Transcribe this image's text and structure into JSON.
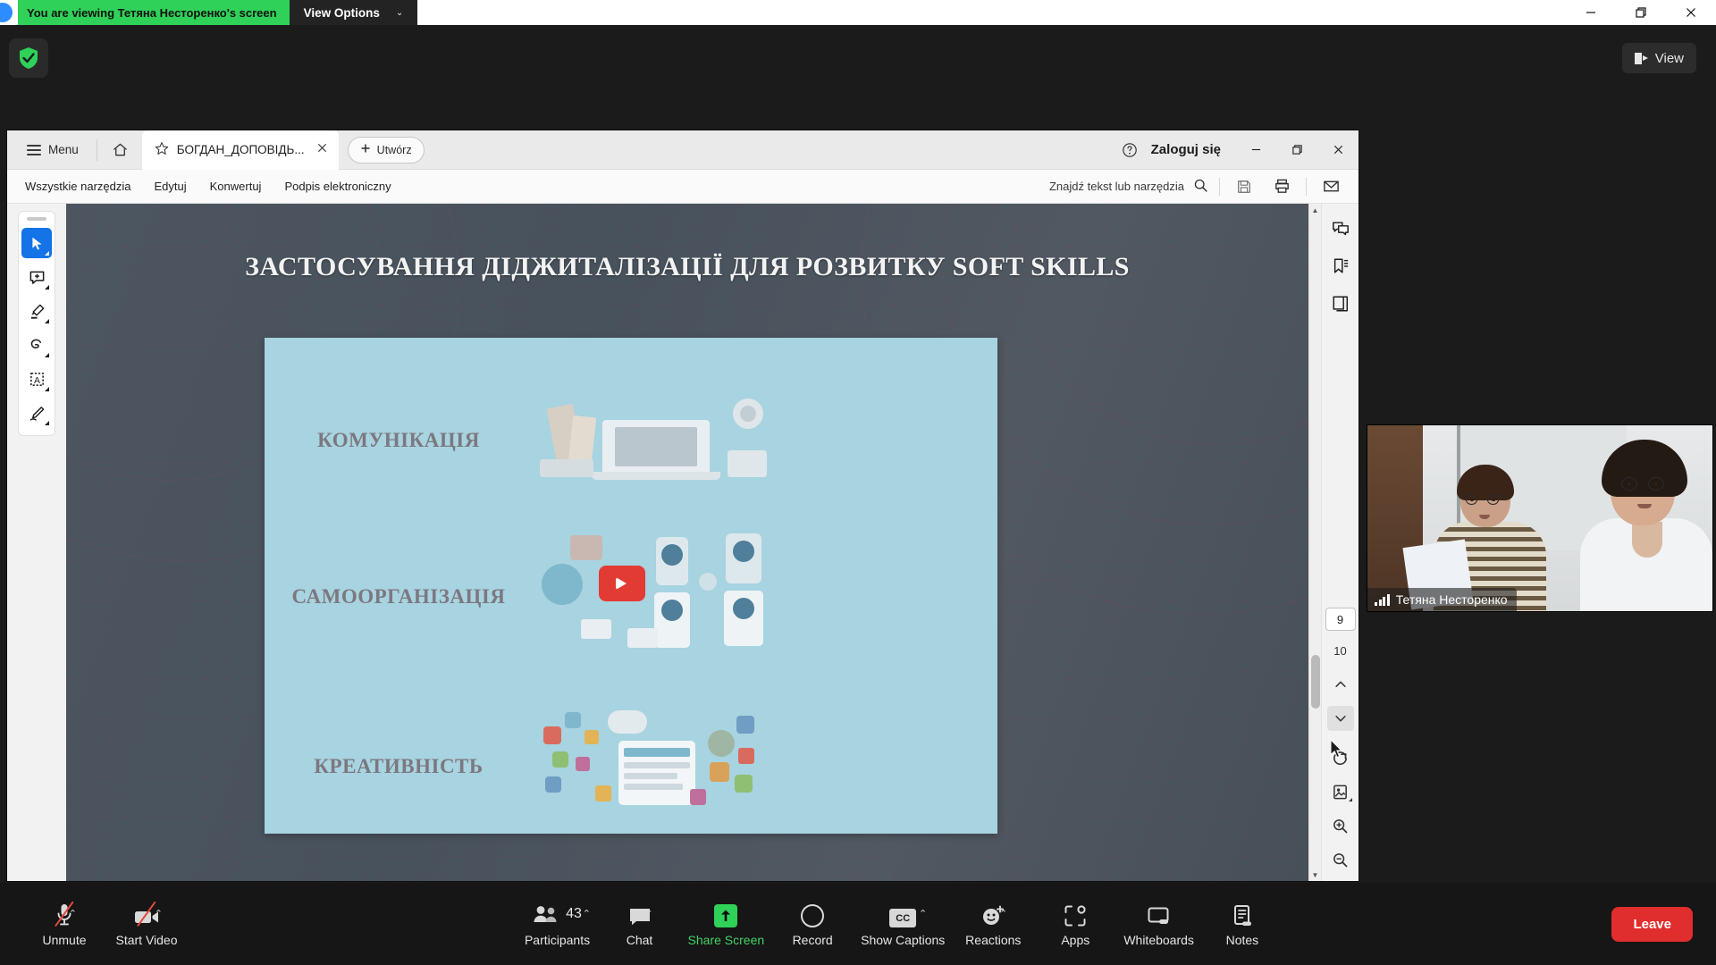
{
  "share_banner": {
    "notice": "You are viewing Тетяна Несторенко's screen",
    "view_options_label": "View Options",
    "caret": "⌄",
    "zoom_orb_icon": "zoom-logo-icon"
  },
  "window_controls": {
    "minimize": "minimize-icon",
    "maximize": "restore-icon",
    "close": "close-icon"
  },
  "zoom_overlay": {
    "shield_icon": "security-shield-icon",
    "view_button_label": "View",
    "view_button_icon": "layout-view-icon"
  },
  "acrobat": {
    "menu_label": "Menu",
    "home_icon": "home-icon",
    "tab": {
      "star_icon": "star-icon",
      "title": "БОГДАН_ДОПОВІДЬ...",
      "close_icon": "close-icon"
    },
    "new_button_label": "Utwórz",
    "new_button_icon": "plus-icon",
    "help_icon": "help-circle-icon",
    "sign_in_label": "Zaloguj się",
    "window_controls": {
      "minimize": "minimize-icon",
      "maximize": "restore-icon",
      "close": "close-icon"
    },
    "menubar": [
      {
        "label": "Wszystkie narzędzia"
      },
      {
        "label": "Edytuj"
      },
      {
        "label": "Konwertuj"
      },
      {
        "label": "Podpis elektroniczny"
      }
    ],
    "find": {
      "placeholder": "Znajdź tekst lub narzędzia",
      "search_icon": "search-icon"
    },
    "toolbar_right_icons": [
      {
        "name": "save-icon"
      },
      {
        "name": "print-icon"
      },
      {
        "name": "mail-icon"
      }
    ],
    "left_tools": [
      {
        "name": "select-cursor-tool",
        "active": true
      },
      {
        "name": "add-comment-tool",
        "active": false
      },
      {
        "name": "highlight-tool",
        "active": false
      },
      {
        "name": "draw-tool",
        "active": false
      },
      {
        "name": "text-select-tool",
        "active": false
      },
      {
        "name": "sign-tool",
        "active": false
      }
    ],
    "right_panel_icons": [
      {
        "name": "comments-icon"
      },
      {
        "name": "bookmarks-icon"
      },
      {
        "name": "pages-icon"
      }
    ],
    "pagination": {
      "current_page": "9",
      "total_pages": "10",
      "prev_icon": "chevron-up-icon",
      "next_icon": "chevron-down-icon"
    },
    "view_tools": [
      {
        "name": "rotate-icon"
      },
      {
        "name": "fit-page-icon"
      },
      {
        "name": "zoom-in-icon"
      },
      {
        "name": "zoom-out-icon"
      }
    ]
  },
  "slide": {
    "title": "ЗАСТОСУВАННЯ ДІДЖИТАЛІЗАЦІЇ ДЛЯ РОЗВИТКУ SOFT SKILLS",
    "card_color": "#a8d3e0",
    "items": [
      {
        "label": "КОМУНІКАЦІЯ",
        "art": "desk-workspace-illustration"
      },
      {
        "label": "САМООРГАНІЗАЦІЯ",
        "art": "social-media-network-illustration"
      },
      {
        "label": "КРЕАТИВНІСТЬ",
        "art": "digital-apps-cloud-illustration"
      }
    ]
  },
  "video_thumbnail": {
    "participant_name": "Тетяна Несторенко",
    "signal_icon": "signal-bars-icon",
    "drag_handle_icon": "drag-handle-icon"
  },
  "zoom_toolbar": {
    "left": [
      {
        "label": "Unmute",
        "icon": "microphone-muted-icon",
        "caret": "⌃",
        "muted": true
      },
      {
        "label": "Start Video",
        "icon": "video-off-icon",
        "caret": "⌃",
        "muted": true
      }
    ],
    "center": [
      {
        "label": "Participants",
        "icon": "participants-icon",
        "caret": "⌃",
        "count": "43"
      },
      {
        "label": "Chat",
        "icon": "chat-icon",
        "caret": "⌃"
      },
      {
        "label": "Share Screen",
        "icon": "share-screen-icon",
        "active": true
      },
      {
        "label": "Record",
        "icon": "record-icon"
      },
      {
        "label": "Show Captions",
        "icon": "closed-captions-icon",
        "caret": "⌃",
        "cc_text": "CC"
      },
      {
        "label": "Reactions",
        "icon": "reactions-icon",
        "caret": "⌃"
      },
      {
        "label": "Apps",
        "icon": "apps-icon"
      },
      {
        "label": "Whiteboards",
        "icon": "whiteboard-icon"
      },
      {
        "label": "Notes",
        "icon": "notes-icon"
      }
    ],
    "leave_label": "Leave"
  },
  "colors": {
    "share_green": "#30d158",
    "leave_red": "#e02d2d",
    "acrobat_blue": "#1473e6",
    "slide_card": "#a8d3e0"
  }
}
